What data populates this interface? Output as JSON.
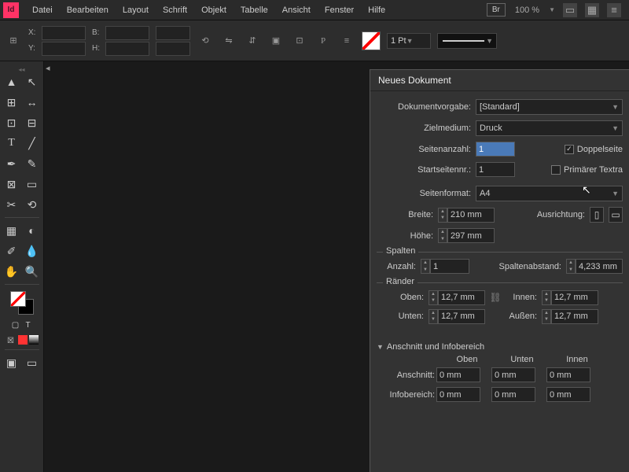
{
  "menubar": {
    "app": "Id",
    "items": [
      "Datei",
      "Bearbeiten",
      "Layout",
      "Schrift",
      "Objekt",
      "Tabelle",
      "Ansicht",
      "Fenster",
      "Hilfe"
    ],
    "br": "Br",
    "zoom": "100 %"
  },
  "controlbar": {
    "x": "X:",
    "y": "Y:",
    "b": "B:",
    "h": "H:",
    "stroke": "1 Pt"
  },
  "dialog": {
    "title": "Neues Dokument",
    "preset_label": "Dokumentvorgabe:",
    "preset_value": "[Standard]",
    "intent_label": "Zielmedium:",
    "intent_value": "Druck",
    "pages_label": "Seitenanzahl:",
    "pages_value": "1",
    "facing_label": "Doppelseite",
    "startpage_label": "Startseitennr.:",
    "startpage_value": "1",
    "primary_tf_label": "Primärer Textra",
    "pagesize_label": "Seitenformat:",
    "pagesize_value": "A4",
    "width_label": "Breite:",
    "width_value": "210 mm",
    "height_label": "Höhe:",
    "height_value": "297 mm",
    "orient_label": "Ausrichtung:",
    "columns_title": "Spalten",
    "col_count_label": "Anzahl:",
    "col_count_value": "1",
    "gutter_label": "Spaltenabstand:",
    "gutter_value": "4,233 mm",
    "margins_title": "Ränder",
    "margin_top_label": "Oben:",
    "margin_top_value": "12,7 mm",
    "margin_bottom_label": "Unten:",
    "margin_bottom_value": "12,7 mm",
    "margin_inside_label": "Innen:",
    "margin_inside_value": "12,7 mm",
    "margin_outside_label": "Außen:",
    "margin_outside_value": "12,7 mm",
    "bleed_title": "Anschnitt und Infobereich",
    "col_top": "Oben",
    "col_bottom": "Unten",
    "col_inner": "Innen",
    "bleed_label": "Anschnitt:",
    "slug_label": "Infobereich:",
    "bleed_value": "0 mm",
    "slug_value": "0 mm"
  }
}
